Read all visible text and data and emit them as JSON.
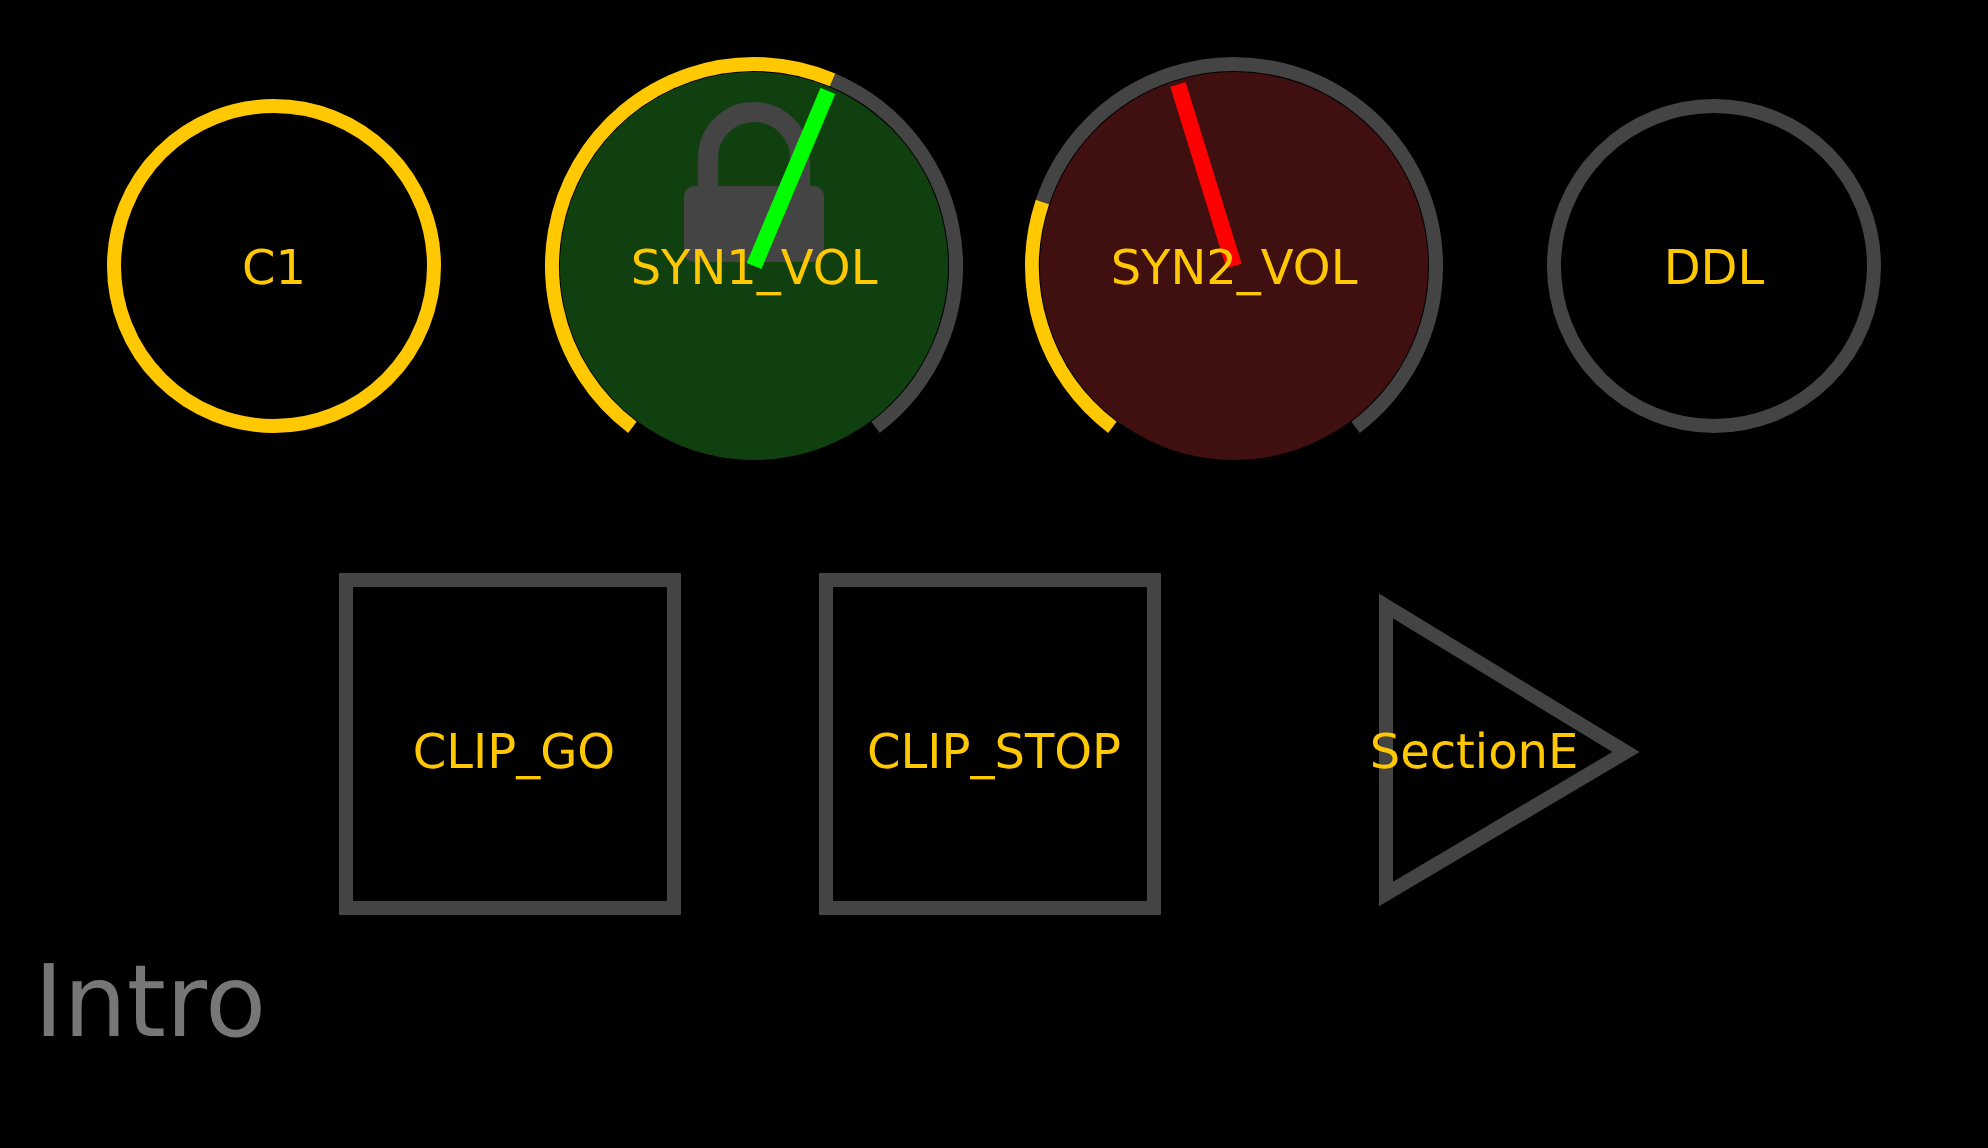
{
  "controls": [
    {
      "kind": "button",
      "label": "C1",
      "on": true
    },
    {
      "kind": "knob",
      "label": "SYN1_VOL",
      "color": "#00ff00",
      "locked": true
    },
    {
      "kind": "knob",
      "label": "SYN2_VOL",
      "color": "#ff0000",
      "locked": false
    },
    {
      "kind": "button",
      "label": "DDL",
      "on": false
    }
  ],
  "pads": [
    {
      "kind": "pad",
      "label": "CLIP_GO"
    },
    {
      "kind": "pad",
      "label": "CLIP_STOP"
    },
    {
      "kind": "scene",
      "label": "SectionE"
    }
  ],
  "page": {
    "title": "Intro"
  }
}
